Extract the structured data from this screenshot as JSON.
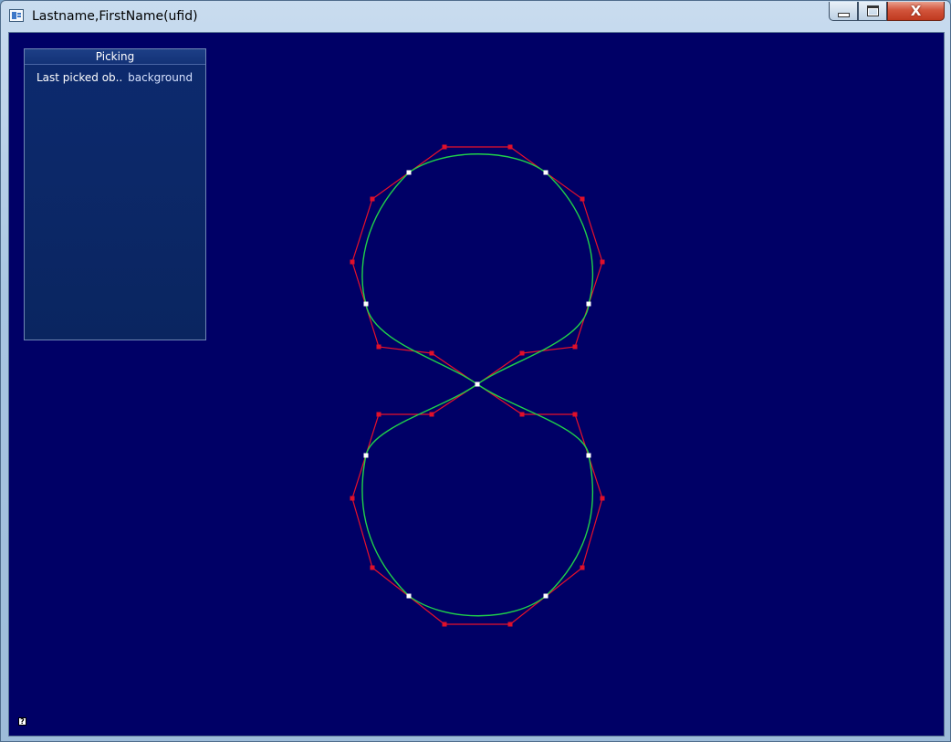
{
  "window": {
    "title": "Lastname,FirstName(ufid)",
    "controls": {
      "minimize": "minimize",
      "maximize": "maximize",
      "close": "X"
    }
  },
  "picking": {
    "header": "Picking",
    "last_picked_label": "Last picked ob..",
    "last_picked_value": "background"
  },
  "help_icon_glyph": "?",
  "colors": {
    "viewport_background": "#000066",
    "control_polygon": "#e8102a",
    "curve": "#1fd14a",
    "control_point": "#e0102a",
    "junction_point": "#ffffff"
  },
  "icons": [
    "app-icon",
    "minimize-icon",
    "maximize-icon",
    "close-icon",
    "help-icon"
  ]
}
